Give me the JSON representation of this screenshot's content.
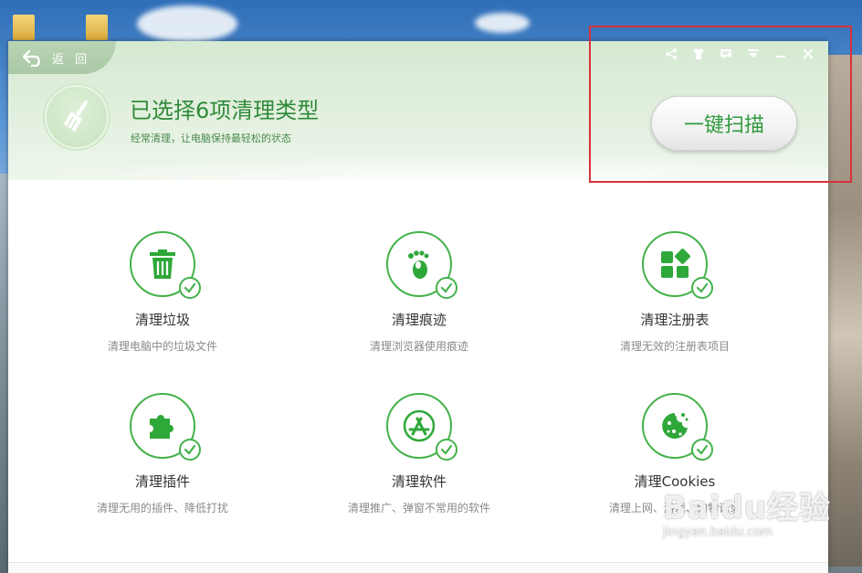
{
  "header": {
    "back_label": "返 回",
    "title": "已选择6项清理类型",
    "subtitle": "经常清理，让电脑保持最轻松的状态",
    "scan_button": "一键扫描",
    "window_icons": [
      "share-icon",
      "skin-icon",
      "message-icon",
      "menu-icon",
      "minimize-icon",
      "close-icon"
    ]
  },
  "items": [
    {
      "label": "清理垃圾",
      "desc": "清理电脑中的垃圾文件",
      "icon": "trash-icon"
    },
    {
      "label": "清理痕迹",
      "desc": "清理浏览器使用痕迹",
      "icon": "footprint-icon"
    },
    {
      "label": "清理注册表",
      "desc": "清理无效的注册表项目",
      "icon": "registry-icon"
    },
    {
      "label": "清理插件",
      "desc": "清理无用的插件、降低打扰",
      "icon": "puzzle-icon"
    },
    {
      "label": "清理软件",
      "desc": "清理推广、弹窗不常用的软件",
      "icon": "app-store-icon"
    },
    {
      "label": "清理Cookies",
      "desc": "清理上网、游戏、购物记录",
      "icon": "cookie-icon"
    }
  ],
  "watermark": {
    "main": "Baidu经验",
    "sub": "jingyan.baidu.com"
  },
  "colors": {
    "accent": "#43b24a",
    "title": "#2f8a3a",
    "highlight": "#d8323a"
  }
}
